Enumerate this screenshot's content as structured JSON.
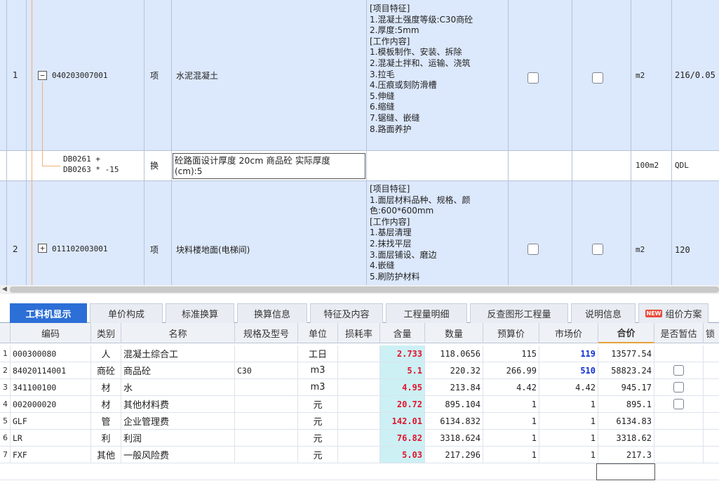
{
  "top_rows": [
    {
      "index": "1",
      "expander": "−",
      "code": "040203007001",
      "type": "项",
      "name": "水泥混凝土",
      "features": "[项目特征]\n1.混凝土强度等级:C30商砼\n2.厚度:5mm\n[工作内容]\n1.模板制作、安装、拆除\n2.混凝土拌和、运输、浇筑\n3.拉毛\n4.压痕或刻防滑槽\n5.伸缝\n6.缩缝\n7.锯缝、嵌缝\n8.路面养护",
      "unit": "m2",
      "qty": "216/0.05"
    },
    {
      "code_line1": "DB0261 +",
      "code_line2": "DB0263 * -15",
      "type": "换",
      "name_line1": "砼路面设计厚度 20cm 商品砼  实际厚度",
      "name_line2": "(cm):5",
      "unit": "100m2",
      "qty": "QDL"
    },
    {
      "index": "2",
      "expander": "+",
      "code": "011102003001",
      "type": "项",
      "name": "块料楼地面(电梯间)",
      "features": "[项目特征]\n1.面层材料品种、规格、颜\n色:600*600mm\n[工作内容]\n1.基层清理\n2.抹找平层\n3.面层铺设、磨边\n4.嵌缝\n5.刷防护材料",
      "unit": "m2",
      "qty": "120"
    }
  ],
  "tabs": [
    {
      "label": "工料机显示",
      "active": true
    },
    {
      "label": "单价构成"
    },
    {
      "label": "标准换算"
    },
    {
      "label": "换算信息"
    },
    {
      "label": "特征及内容"
    },
    {
      "label": "工程量明细"
    },
    {
      "label": "反查图形工程量"
    },
    {
      "label": "说明信息"
    },
    {
      "label": "组价方案",
      "badge": "NEW"
    }
  ],
  "material_table": {
    "headers": [
      "编码",
      "类别",
      "名称",
      "规格及型号",
      "单位",
      "损耗率",
      "含量",
      "数量",
      "预算价",
      "市场价",
      "合价",
      "是否暂估",
      "锁"
    ],
    "rows": [
      {
        "index": "1",
        "code": "000300080",
        "category": "人",
        "name": "混凝土综合工",
        "spec": "",
        "unit": "工日",
        "loss": "",
        "content": "2.733",
        "qty": "118.0656",
        "budget": "115",
        "market": "119",
        "total": "13577.54",
        "estimate": false
      },
      {
        "index": "2",
        "code": "84020114001",
        "category": "商砼",
        "name": "商品砼",
        "spec": "C30",
        "unit": "m3",
        "loss": "",
        "content": "5.1",
        "qty": "220.32",
        "budget": "266.99",
        "market": "510",
        "total": "58823.24",
        "estimate": true
      },
      {
        "index": "3",
        "code": "341100100",
        "category": "材",
        "name": "水",
        "spec": "",
        "unit": "m3",
        "loss": "",
        "content": "4.95",
        "qty": "213.84",
        "budget": "4.42",
        "market": "4.42",
        "total": "945.17",
        "estimate": true
      },
      {
        "index": "4",
        "code": "002000020",
        "category": "材",
        "name": "其他材料费",
        "spec": "",
        "unit": "元",
        "loss": "",
        "content": "20.72",
        "qty": "895.104",
        "budget": "1",
        "market": "1",
        "total": "895.1",
        "estimate": true
      },
      {
        "index": "5",
        "code": "GLF",
        "category": "管",
        "name": "企业管理费",
        "spec": "",
        "unit": "元",
        "loss": "",
        "content": "142.01",
        "qty": "6134.832",
        "budget": "1",
        "market": "1",
        "total": "6134.83",
        "estimate": false
      },
      {
        "index": "6",
        "code": "LR",
        "category": "利",
        "name": "利润",
        "spec": "",
        "unit": "元",
        "loss": "",
        "content": "76.82",
        "qty": "3318.624",
        "budget": "1",
        "market": "1",
        "total": "3318.62",
        "estimate": false
      },
      {
        "index": "7",
        "code": "FXF",
        "category": "其他",
        "name": "一般风险费",
        "spec": "",
        "unit": "元",
        "loss": "",
        "content": "5.03",
        "qty": "217.296",
        "budget": "1",
        "market": "1",
        "total": "217.3",
        "estimate": false
      }
    ]
  },
  "colors": {
    "row_highlight": "#dce8fb",
    "tab_active": "#2c6fd6",
    "content_bg": "#ccf0f4",
    "content_text": "#e3122b",
    "market_text": "#1030d8"
  }
}
